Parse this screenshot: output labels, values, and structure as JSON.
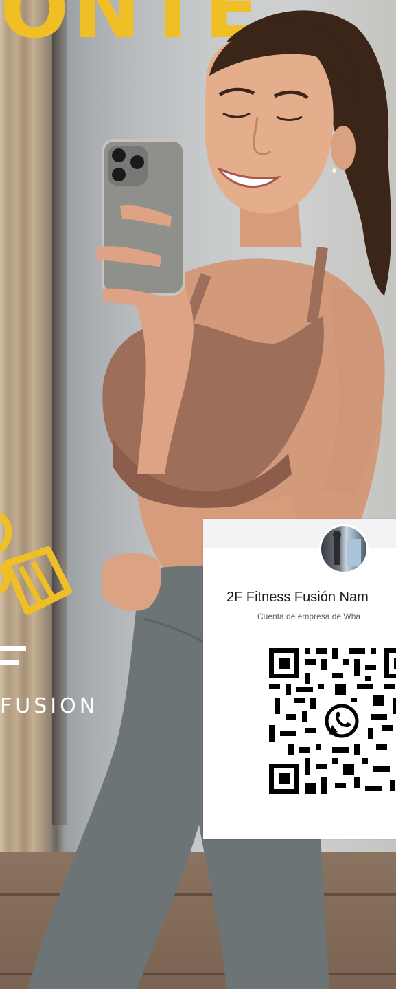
{
  "banner": {
    "headline": "ONTE"
  },
  "logo": {
    "letter": "F",
    "wordmark": "FUSION",
    "accent_color": "#f0be25"
  },
  "qr_card": {
    "business_name": "2F Fitness Fusión Nam",
    "subtitle": "Cuenta de empresa de Wha",
    "icons": [
      "whatsapp-icon",
      "qr-code"
    ]
  },
  "colors": {
    "brand_yellow": "#f0be25",
    "card_background": "#ffffff",
    "card_header": "#f2f3f5",
    "name_text": "#111b21",
    "subtitle_text": "#54656f"
  }
}
